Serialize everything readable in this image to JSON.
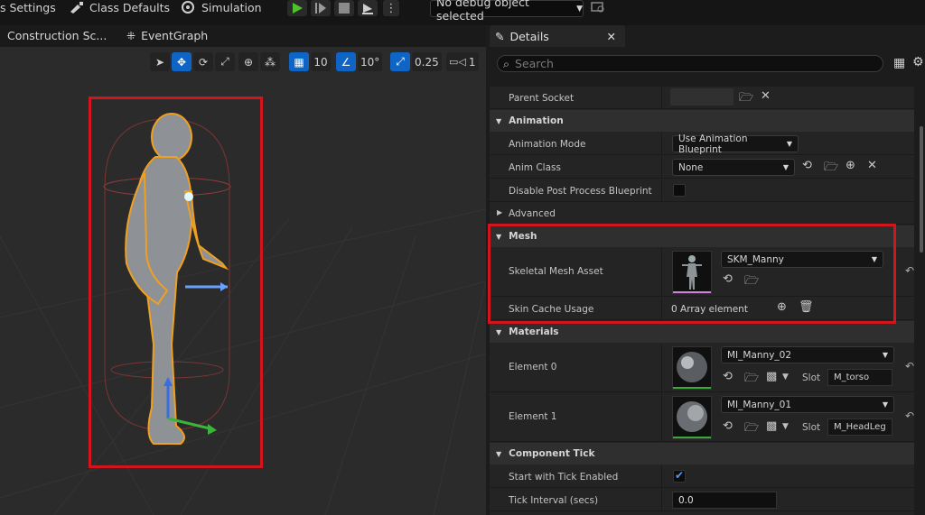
{
  "toolbar": {
    "settings_label": "s Settings",
    "class_defaults_label": "Class Defaults",
    "simulation_label": "Simulation",
    "debug_object": "No debug object selected"
  },
  "tabs": {
    "construction": "Construction Sc...",
    "event_graph": "EventGraph"
  },
  "viewport_tools": {
    "grid_snap": "10",
    "rotation_snap": "10°",
    "scale_snap": "0.25",
    "camera_speed": "1"
  },
  "details": {
    "tab_label": "Details",
    "search_placeholder": "Search",
    "parent_socket_label": "Parent Socket",
    "animation_header": "Animation",
    "animation_mode_label": "Animation Mode",
    "animation_mode_value": "Use Animation Blueprint",
    "anim_class_label": "Anim Class",
    "anim_class_value": "None",
    "disable_pp_label": "Disable Post Process Blueprint",
    "advanced_label": "Advanced",
    "mesh_header": "Mesh",
    "skeletal_mesh_label": "Skeletal Mesh Asset",
    "skeletal_mesh_value": "SKM_Manny",
    "skin_cache_label": "Skin Cache Usage",
    "skin_cache_value": "0 Array element",
    "materials_header": "Materials",
    "element0_label": "Element 0",
    "element0_value": "MI_Manny_02",
    "element0_slot_label": "Slot",
    "element0_slot_value": "M_torso",
    "element1_label": "Element 1",
    "element1_value": "MI_Manny_01",
    "element1_slot_label": "Slot",
    "element1_slot_value": "M_HeadLeg",
    "component_tick_header": "Component Tick",
    "start_tick_label": "Start with Tick Enabled",
    "tick_interval_label": "Tick Interval (secs)",
    "tick_interval_value": "0.0"
  },
  "colors": {
    "highlight_box": "#d2141c",
    "accent_blue": "#0e65c6",
    "play_green": "#4cc22c"
  }
}
